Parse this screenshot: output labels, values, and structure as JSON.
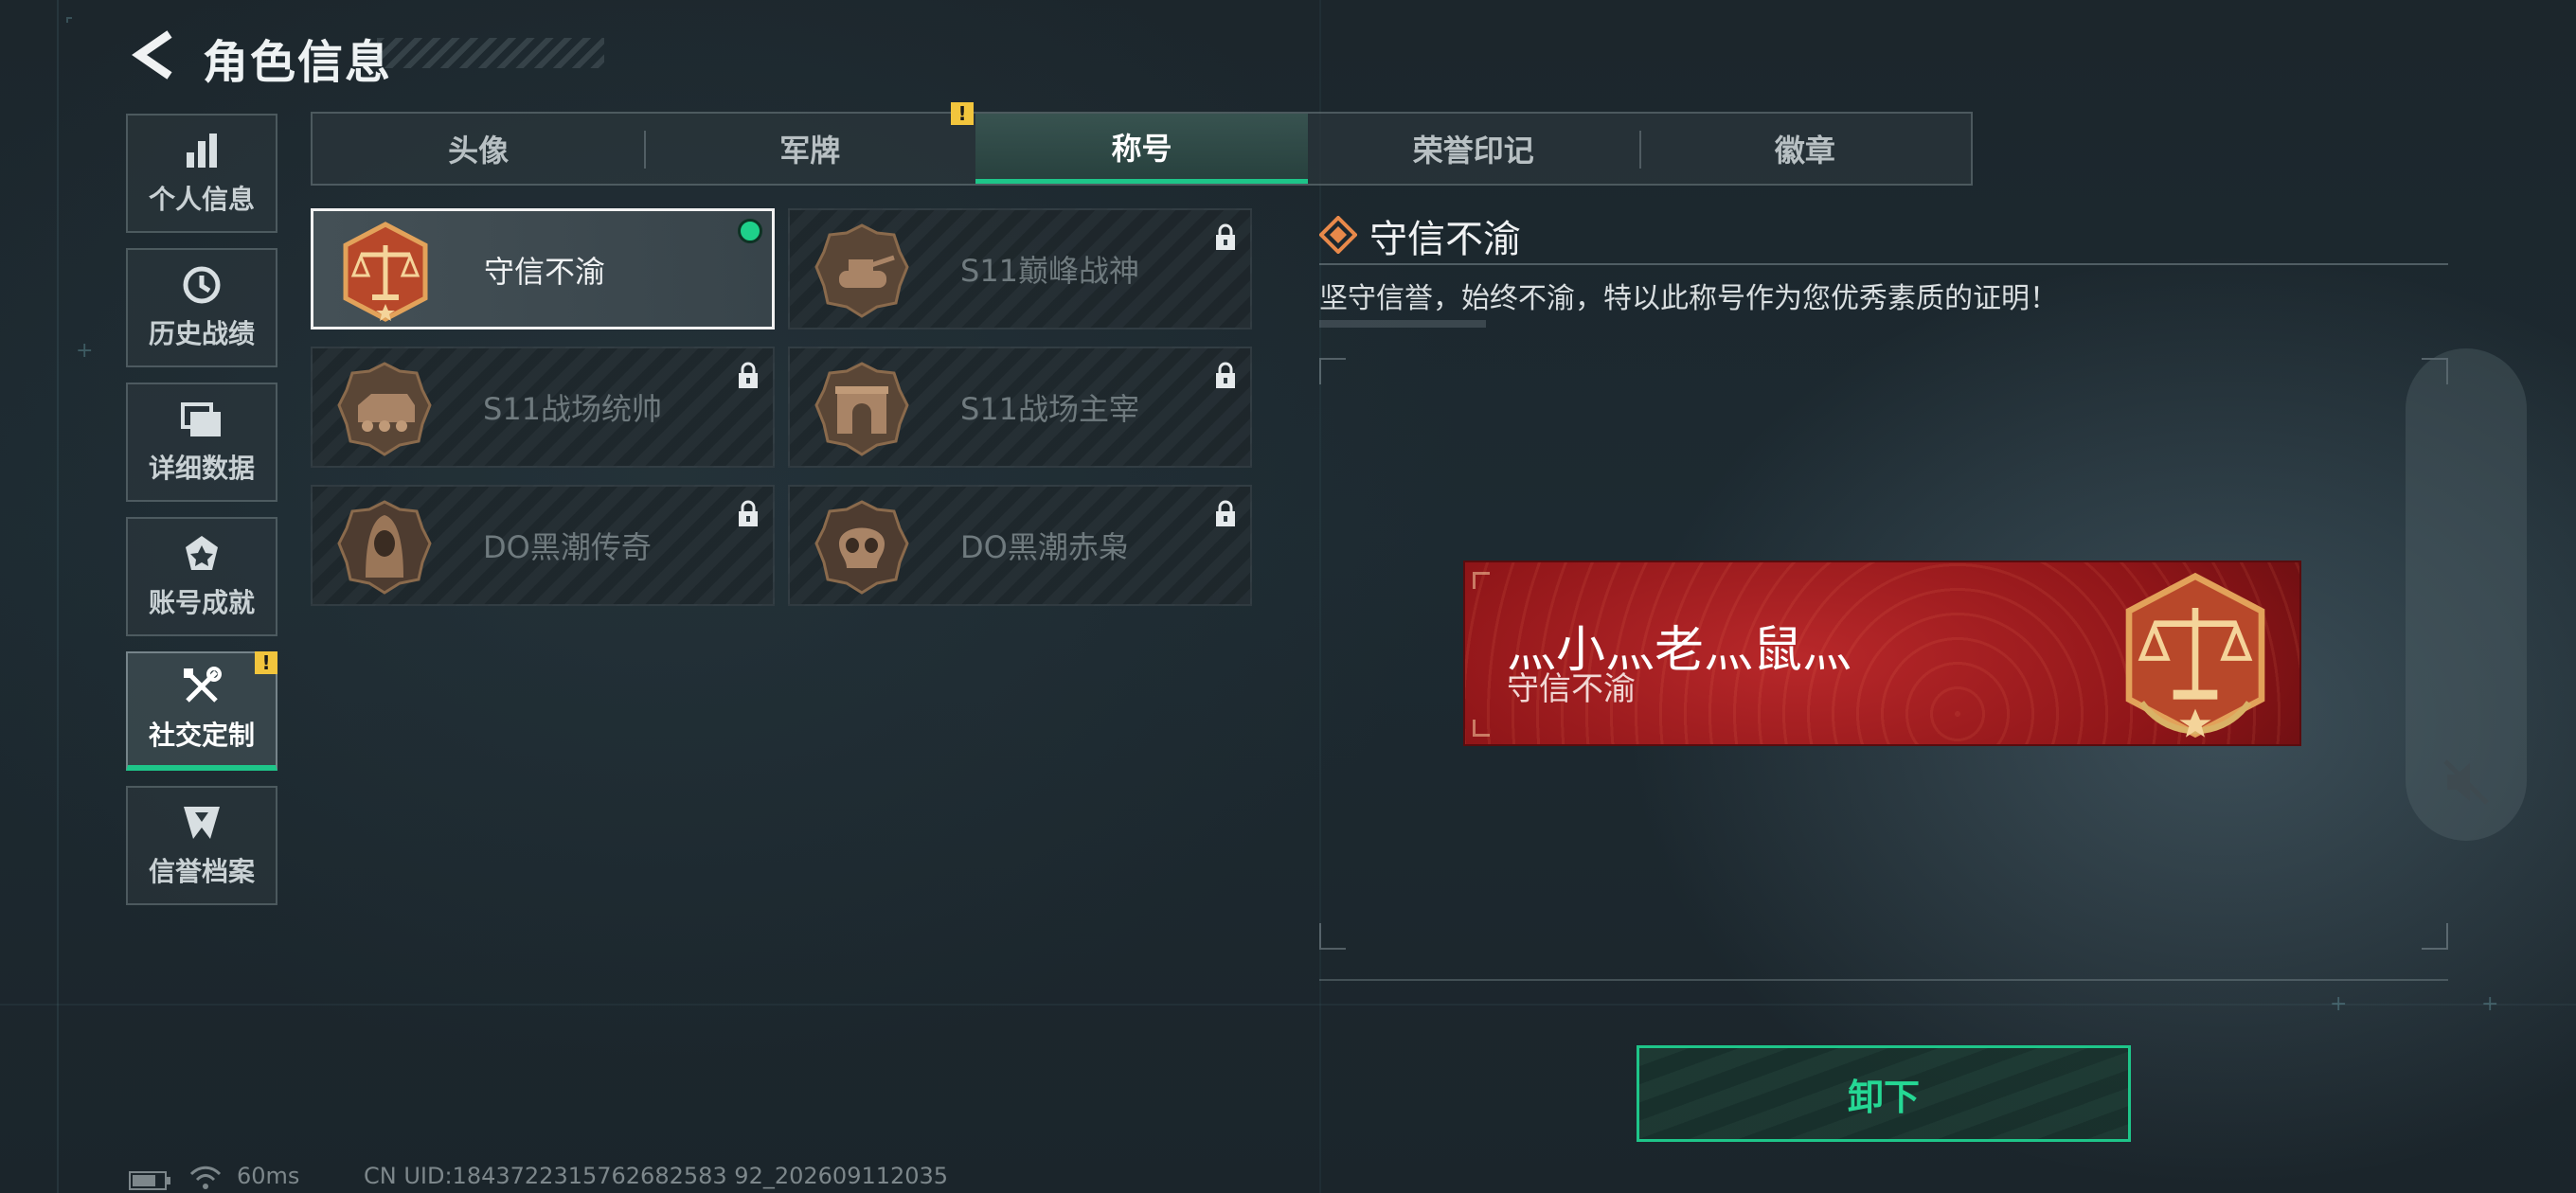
{
  "header": {
    "title": "角色信息"
  },
  "sidebar": {
    "items": [
      {
        "label": "个人信息",
        "icon": "bar-chart-icon",
        "active": false
      },
      {
        "label": "历史战绩",
        "icon": "history-icon",
        "active": false
      },
      {
        "label": "详细数据",
        "icon": "folders-icon",
        "active": false
      },
      {
        "label": "账号成就",
        "icon": "achievement-icon",
        "active": false
      },
      {
        "label": "社交定制",
        "icon": "tools-icon",
        "active": true,
        "badge": "!"
      },
      {
        "label": "信誉档案",
        "icon": "credit-icon",
        "active": false
      }
    ]
  },
  "tabs": [
    {
      "label": "头像",
      "active": false
    },
    {
      "label": "军牌",
      "active": false,
      "badge": "!"
    },
    {
      "label": "称号",
      "active": true
    },
    {
      "label": "荣誉印记",
      "active": false
    },
    {
      "label": "徽章",
      "active": false
    }
  ],
  "titles": [
    {
      "name": "守信不渝",
      "medal": "scales-medal-icon",
      "locked": false,
      "equipped": true
    },
    {
      "name": "S11巅峰战神",
      "medal": "tank-medal-icon",
      "locked": true,
      "equipped": false
    },
    {
      "name": "S11战场统帅",
      "medal": "apc-medal-icon",
      "locked": true,
      "equipped": false
    },
    {
      "name": "S11战场主宰",
      "medal": "arch-medal-icon",
      "locked": true,
      "equipped": false
    },
    {
      "name": "DO黑潮传奇",
      "medal": "hooded-figure-medal-icon",
      "locked": true,
      "equipped": false
    },
    {
      "name": "DO黑潮赤枭",
      "medal": "skull-medal-icon",
      "locked": true,
      "equipped": false
    }
  ],
  "detail": {
    "name": "守信不渝",
    "description": "坚守信誉，始终不渝，特以此称号作为您优秀素质的证明！"
  },
  "preview": {
    "player_name": "灬小灬老灬鼠灬",
    "title": "守信不渝"
  },
  "actions": {
    "unequip_label": "卸下"
  },
  "status_bar": {
    "ping": "60ms",
    "uid": "CN UID:1843722315762682583 92_202609112035"
  },
  "colors": {
    "accent_green": "#1ec589",
    "warning_yellow": "#f2c53d",
    "banner_red": "#a81e21",
    "medal_bronze": "#b86a2c"
  }
}
